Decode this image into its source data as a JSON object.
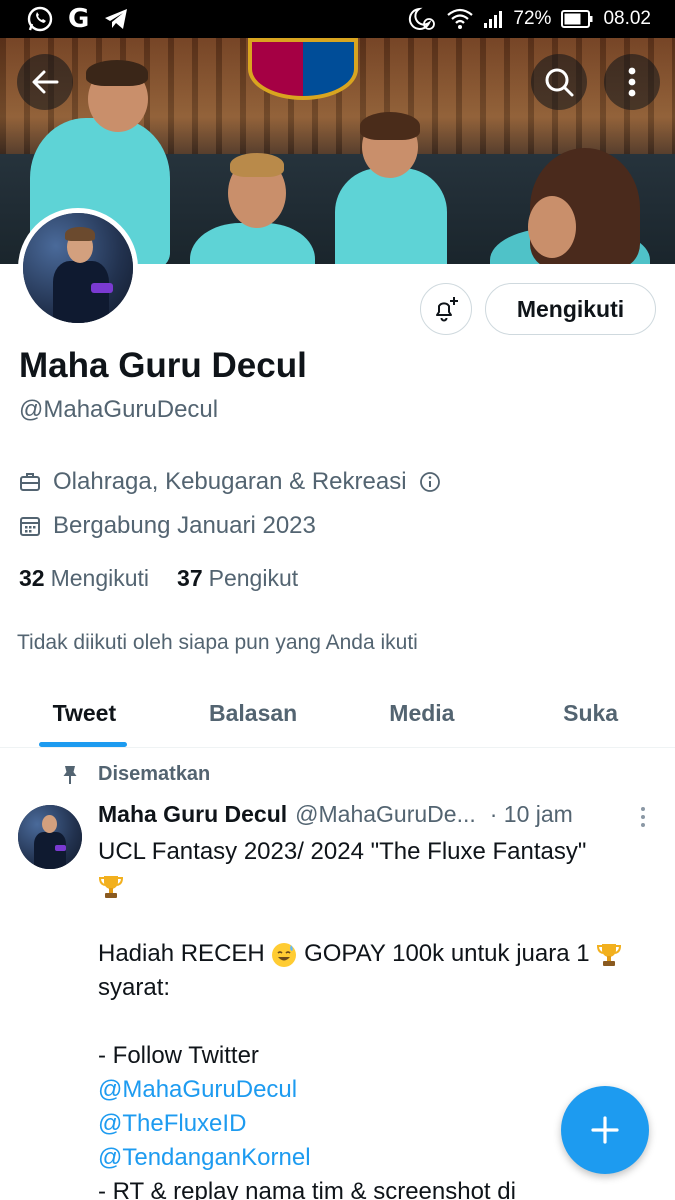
{
  "status_bar": {
    "battery": "72%",
    "time": "08.02",
    "left_icons": [
      "whatsapp-icon",
      "google-icon",
      "telegram-icon"
    ],
    "right_icons": [
      "alarm-moon-icon",
      "wifi-icon",
      "signal-icon",
      "battery-icon"
    ]
  },
  "profile": {
    "name": "Maha Guru Decul",
    "handle": "@MahaGuruDecul",
    "category": "Olahraga, Kebugaran & Rekreasi",
    "joined": "Bergabung Januari 2023",
    "following_count": "32",
    "following_label": "Mengikuti",
    "followers_count": "37",
    "followers_label": "Pengikut",
    "not_followed_text": "Tidak diikuti oleh siapa pun yang Anda ikuti",
    "follow_button": "Mengikuti"
  },
  "tabs": [
    {
      "label": "Tweet",
      "active": true
    },
    {
      "label": "Balasan",
      "active": false
    },
    {
      "label": "Media",
      "active": false
    },
    {
      "label": "Suka",
      "active": false
    }
  ],
  "tweet": {
    "pinned_label": "Disematkan",
    "author_name": "Maha Guru Decul",
    "author_handle": "@MahaGuruDe...",
    "time": "· 10 jam",
    "lines": [
      "UCL Fantasy 2023/ 2024 \"The Fluxe Fantasy\"",
      "",
      "",
      "Hadiah RECEH",
      "syarat:",
      "",
      "- Follow Twitter",
      "@MahaGuruDecul",
      "@TheFluxeID",
      "@TendanganKornel",
      "- RT & replay nama tim & screenshot di"
    ],
    "line4_rest": " GOPAY 100k untuk juara 1 "
  },
  "colors": {
    "accent": "#1d9bf0",
    "text_primary": "#0f1419",
    "text_secondary": "#536471",
    "border": "#cfd9de"
  }
}
